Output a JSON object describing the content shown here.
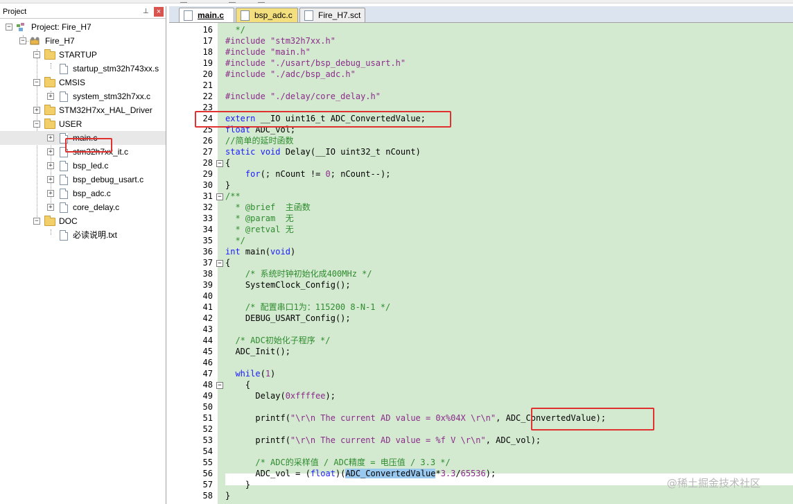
{
  "project_panel": {
    "title": "Project",
    "pin_icon": "pin-icon",
    "close_label": "×",
    "tree": {
      "project": "Project: Fire_H7",
      "target": "Fire_H7",
      "groups": [
        {
          "name": "STARTUP",
          "files": [
            "startup_stm32h743xx.s"
          ]
        },
        {
          "name": "CMSIS",
          "files": [
            "system_stm32h7xx.c"
          ]
        },
        {
          "name": "STM32H7xx_HAL_Driver",
          "files": []
        },
        {
          "name": "USER",
          "files": [
            "main.c",
            "stm32h7xx_it.c",
            "bsp_led.c",
            "bsp_debug_usart.c",
            "bsp_adc.c",
            "core_delay.c"
          ]
        },
        {
          "name": "DOC",
          "files": [
            "必读说明.txt"
          ]
        }
      ]
    }
  },
  "editor": {
    "tabs": [
      {
        "label": "main.c",
        "active": true
      },
      {
        "label": "bsp_adc.c",
        "active": false
      },
      {
        "label": "Fire_H7.sct",
        "active": false
      }
    ],
    "line_numbers": [
      "16",
      "17",
      "18",
      "19",
      "20",
      "21",
      "22",
      "23",
      "24",
      "25",
      "26",
      "27",
      "28",
      "29",
      "30",
      "31",
      "32",
      "33",
      "34",
      "35",
      "36",
      "37",
      "38",
      "39",
      "40",
      "41",
      "42",
      "43",
      "44",
      "45",
      "46",
      "47",
      "48",
      "49",
      "50",
      "51",
      "52",
      "53",
      "54",
      "55",
      "56",
      "57",
      "58"
    ],
    "code": {
      "l16": "  */",
      "l17a": "#include ",
      "l17b": "\"stm32h7xx.h\"",
      "l18a": "#include ",
      "l18b": "\"main.h\"",
      "l19a": "#include ",
      "l19b": "\"./usart/bsp_debug_usart.h\"",
      "l20a": "#include ",
      "l20b": "\"./adc/bsp_adc.h\"",
      "l22a": "#include ",
      "l22b": "\"./delay/core_delay.h\"",
      "l24a": "extern",
      "l24b": " __IO uint16_t ADC_ConvertedValue;",
      "l25a": "float",
      "l25b": " ADC_vol;",
      "l26": "//简单的延时函数",
      "l27a": "static",
      "l27b": " ",
      "l27c": "void",
      "l27d": " Delay(__IO uint32_t nCount)",
      "l28": "{",
      "l29a": "    ",
      "l29b": "for",
      "l29c": "(; nCount != ",
      "l29d": "0",
      "l29e": "; nCount--);",
      "l30": "}",
      "l31": "/**",
      "l32a": "  * @brief  ",
      "l32b": "主函数",
      "l33a": "  * @param  ",
      "l33b": "无",
      "l34a": "  * @retval ",
      "l34b": "无",
      "l35": "  */",
      "l36a": "int",
      "l36b": " main(",
      "l36c": "void",
      "l36d": ")",
      "l37": "{",
      "l38a": "    ",
      "l38b": "/* 系统时钟初始化成400MHz */",
      "l39": "    SystemClock_Config();",
      "l41a": "    ",
      "l41b": "/* 配置串口1为：115200 8-N-1 */",
      "l42": "    DEBUG_USART_Config();",
      "l44a": "  ",
      "l44b": "/* ADC初始化子程序 */",
      "l45": "  ADC_Init();",
      "l47a": "  ",
      "l47b": "while",
      "l47c": "(",
      "l47d": "1",
      "l47e": ")",
      "l48": "    {",
      "l49a": "      Delay(",
      "l49b": "0xffffee",
      "l49c": ");",
      "l51a": "      printf(",
      "l51b": "\"\\r\\n The current AD value = 0x%04X \\r\\n\"",
      "l51c": ", ADC_ConvertedValue);",
      "l53a": "      printf(",
      "l53b": "\"\\r\\n The current AD value = %f V \\r\\n\"",
      "l53c": ", ADC_vol);",
      "l55a": "      ",
      "l55b": "/* ADC的采样值 / ADC精度 = 电压值 / 3.3 */",
      "l56a": "      ADC_vol = (",
      "l56b": "float",
      "l56c": ")(",
      "l56d": "ADC_ConvertedValue",
      "l56e": "*",
      "l56f": "3.3",
      "l56g": "/",
      "l56h": "65536",
      "l56i": ");",
      "l57": "    }",
      "l58": "}"
    }
  },
  "watermark": "@稀土掘金技术社区",
  "colors": {
    "code_bg": "#d3ead0",
    "keyword": "#1a1aff",
    "comment": "#2e8b2e",
    "string": "#8b2a8b",
    "highlight_box": "#e03030",
    "selection": "#99c9ef"
  }
}
